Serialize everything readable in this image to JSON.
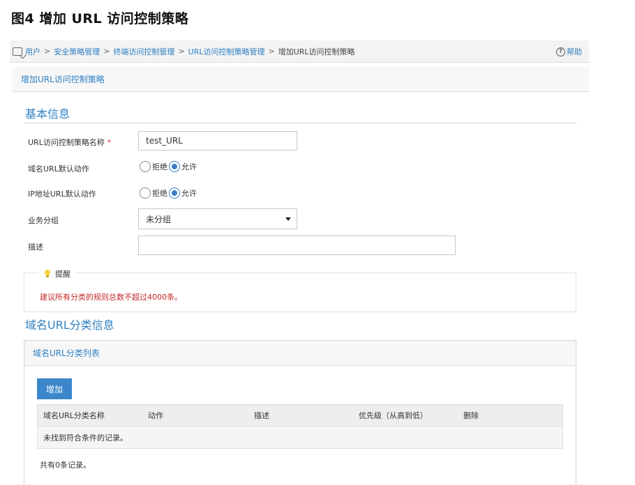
{
  "document": {
    "figure_title": "图4  增加 URL 访问控制策略"
  },
  "breadcrumb": {
    "items": [
      "用户",
      "安全策略管理",
      "终端访问控制管理",
      "URL访问控制策略管理"
    ],
    "separator": ">",
    "current": "增加URL访问控制策略",
    "help_label": "帮助"
  },
  "panel": {
    "title": "增加URL访问控制策略"
  },
  "basic_info": {
    "section_title": "基本信息",
    "name_label": "URL访问控制策略名称",
    "required_mark": "*",
    "name_value": "test_URL",
    "domain_default_label": "域名URL默认动作",
    "ip_default_label": "IP地址URL默认动作",
    "options": {
      "deny": "拒绝",
      "allow": "允许"
    },
    "domain_default_selected": "allow",
    "ip_default_selected": "allow",
    "group_label": "业务分组",
    "group_value": "未分组",
    "desc_label": "描述",
    "desc_value": ""
  },
  "tip": {
    "title": "提醒",
    "text": "建议所有分类的规则总数不超过4000条。"
  },
  "domain_category": {
    "section_title": "域名URL分类信息",
    "list_title": "域名URL分类列表",
    "add_button": "增加",
    "columns": [
      "域名URL分类名称",
      "动作",
      "描述",
      "优先级（从高到低）",
      "删除"
    ],
    "empty_text": "未找到符合条件的记录。",
    "footer": "共有0条记录。"
  },
  "colors": {
    "link": "#2f7fc1",
    "primary_button": "#3a87cb",
    "warning_text": "#c62828",
    "radio_selected": "#3a7fc8"
  },
  "icons": {
    "breadcrumb": "user-manage-icon",
    "help": "question-circle-icon",
    "tip": "lightbulb-icon",
    "select": "caret-down-icon"
  }
}
